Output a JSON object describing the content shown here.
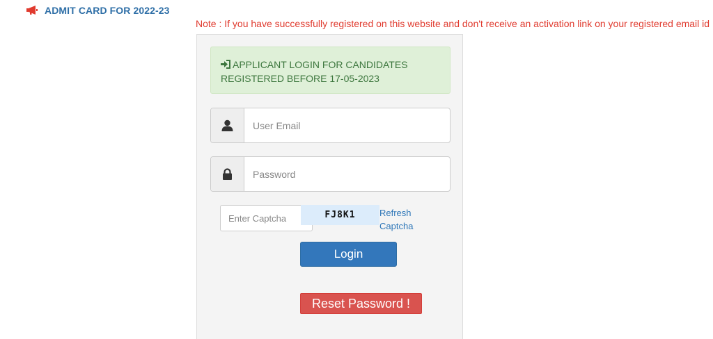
{
  "header": {
    "icon": "megaphone-icon",
    "title": "ADMIT CARD FOR 2022-23"
  },
  "note": "Note : If you have successfully registered on this website and don't receive an activation link on your registered email id",
  "login_panel": {
    "alert_icon": "sign-in-icon",
    "alert_text_line1": "APPLICANT LOGIN FOR CANDIDATES",
    "alert_text_line2": "REGISTERED BEFORE 17-05-2023",
    "email": {
      "icon": "user-icon",
      "placeholder": "User Email",
      "value": ""
    },
    "password": {
      "icon": "lock-icon",
      "placeholder": "Password",
      "value": ""
    },
    "captcha": {
      "placeholder": "Enter Captcha",
      "code": "FJ8K1",
      "refresh_label": "Refresh Captcha"
    },
    "login_label": "Login",
    "reset_label": "Reset Password !"
  },
  "colors": {
    "header_blue": "#2f6fa7",
    "note_red": "#e03a2e",
    "alert_bg": "#dff0d8",
    "alert_text": "#3c763d",
    "login_btn": "#3377bb",
    "reset_btn": "#d9534f",
    "captcha_bg": "#dcecfb"
  }
}
